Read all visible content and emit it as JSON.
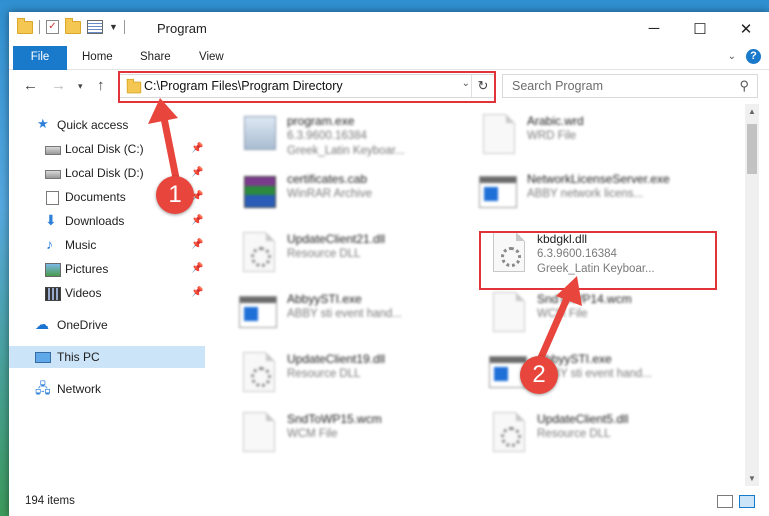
{
  "window": {
    "title": "Program",
    "minimize_glyph": "─",
    "maximize_glyph": "☐",
    "close_glyph": "✕"
  },
  "ribbon": {
    "tabs": [
      "File",
      "Home",
      "Share",
      "View"
    ]
  },
  "address": {
    "path": "C:\\Program Files\\Program Directory",
    "refresh_glyph": "↻",
    "dropdown_glyph": "⌄"
  },
  "search": {
    "placeholder": "Search Program"
  },
  "sidebar": {
    "items": [
      {
        "label": "Quick access",
        "icon": "star-icon"
      },
      {
        "label": "Local Disk (C:)",
        "icon": "disk-icon",
        "pinned": true
      },
      {
        "label": "Local Disk (D:)",
        "icon": "disk-icon",
        "pinned": true
      },
      {
        "label": "Documents",
        "icon": "documents-icon",
        "pinned": true
      },
      {
        "label": "Downloads",
        "icon": "download-icon",
        "pinned": true
      },
      {
        "label": "Music",
        "icon": "music-icon",
        "pinned": true
      },
      {
        "label": "Pictures",
        "icon": "pictures-icon",
        "pinned": true
      },
      {
        "label": "Videos",
        "icon": "videos-icon",
        "pinned": true
      },
      {
        "label": "OneDrive",
        "icon": "onedrive-icon"
      },
      {
        "label": "This PC",
        "icon": "computer-icon",
        "selected": true
      },
      {
        "label": "Network",
        "icon": "network-icon"
      }
    ]
  },
  "files": [
    {
      "name": "program.exe",
      "line2": "6.3.9600.16384",
      "line3": "Greek_Latin Keyboar...",
      "icon": "setup-icon"
    },
    {
      "name": "Arabic.wrd",
      "line2": "WRD File",
      "line3": "",
      "icon": "document-icon"
    },
    {
      "name": "certificates.cab",
      "line2": "WinRAR Archive",
      "line3": "",
      "icon": "winrar-icon"
    },
    {
      "name": "NetworkLicenseServer.exe",
      "line2": "ABBY network licens...",
      "line3": "",
      "icon": "app-icon"
    },
    {
      "name": "UpdateClient21.dll",
      "line2": "Resource DLL",
      "line3": "",
      "icon": "dll-icon"
    },
    {
      "name": "kbdgkl.dll",
      "line2": "6.3.9600.16384",
      "line3": "Greek_Latin Keyboar...",
      "icon": "dll-icon"
    },
    {
      "name": "AbbyySTI.exe",
      "line2": "ABBY sti event hand...",
      "line3": "",
      "icon": "app-icon"
    },
    {
      "name": "SndToWP14.wcm",
      "line2": "WCM File",
      "line3": "",
      "icon": "document-icon"
    },
    {
      "name": "UpdateClient19.dll",
      "line2": "Resource DLL",
      "line3": "",
      "icon": "dll-icon"
    },
    {
      "name": "AbbyySTI.exe",
      "line2": "ABBY sti event hand...",
      "line3": "",
      "icon": "app-icon"
    },
    {
      "name": "SndToWP15.wcm",
      "line2": "WCM File",
      "line3": "",
      "icon": "document-icon"
    },
    {
      "name": "UpdateClient5.dll",
      "line2": "Resource DLL",
      "line3": "",
      "icon": "dll-icon"
    }
  ],
  "callouts": [
    "1",
    "2"
  ],
  "status": {
    "item_count": "194 items"
  },
  "colors": {
    "accent": "#1979ca",
    "highlight_red": "#e0343a",
    "callout_red": "#e8453c",
    "selection": "#cce4f7"
  }
}
